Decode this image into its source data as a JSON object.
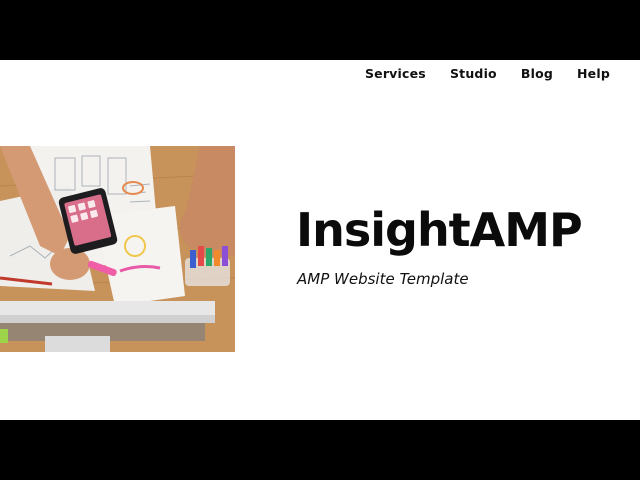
{
  "nav": {
    "items": [
      {
        "label": "Services"
      },
      {
        "label": "Studio"
      },
      {
        "label": "Blog"
      },
      {
        "label": "Help"
      }
    ]
  },
  "hero": {
    "title": "InsightAMP",
    "subtitle": "AMP Website Template",
    "image_alt": "desk-workspace-photo"
  },
  "colors": {
    "letterbox": "#000000",
    "page_background": "#ffffff",
    "text": "#111111"
  }
}
